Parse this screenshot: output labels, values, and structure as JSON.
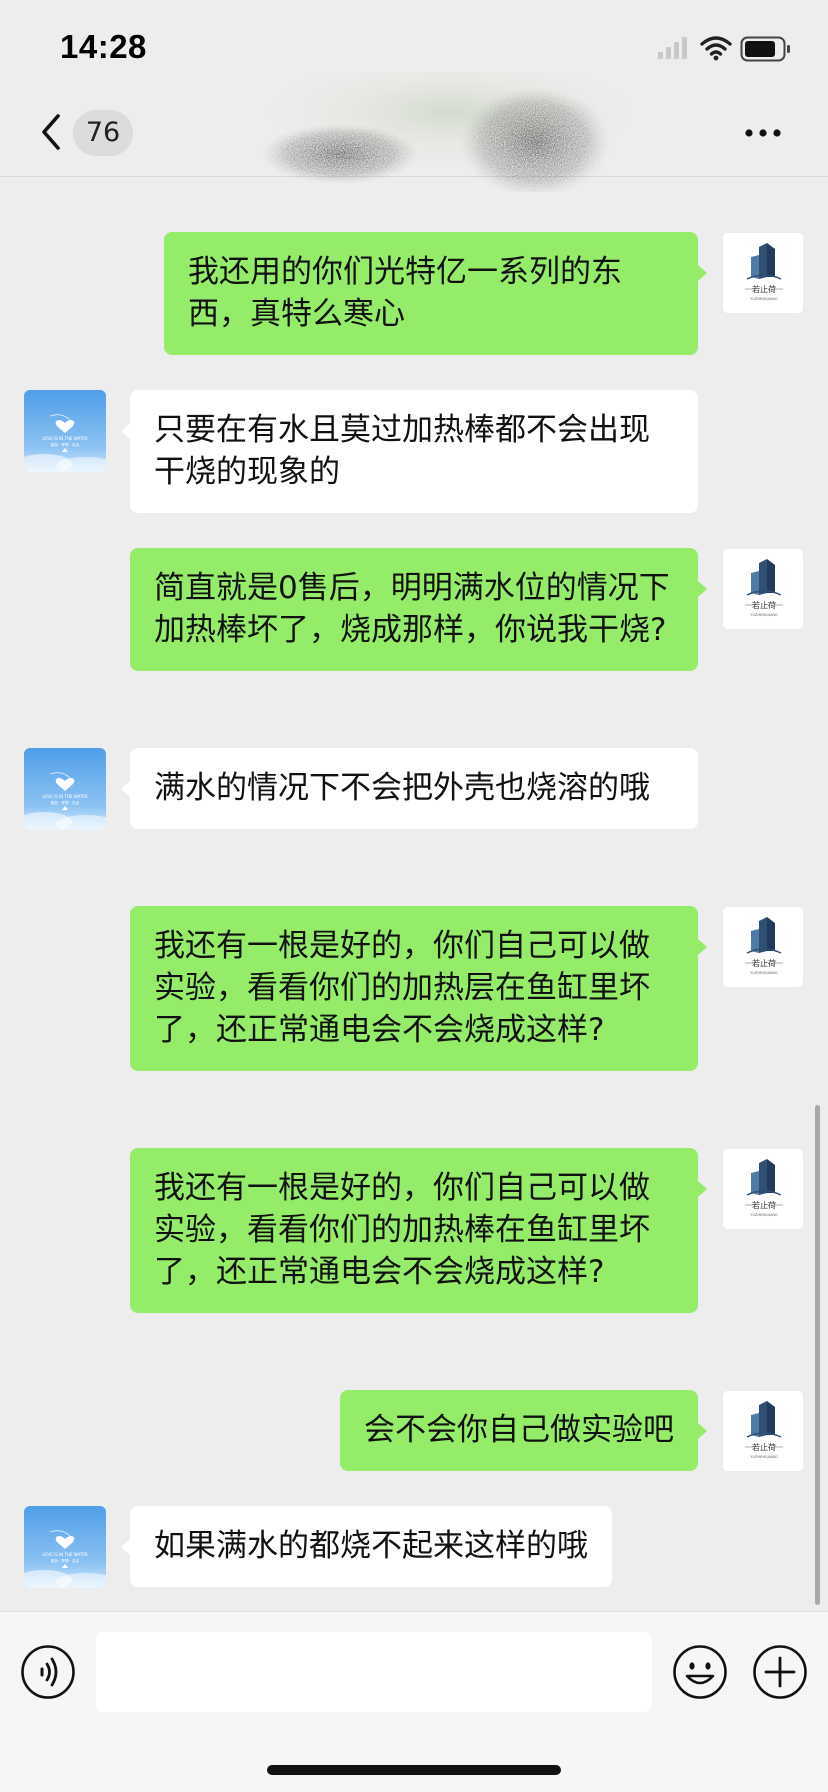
{
  "status_bar": {
    "time": "14:28"
  },
  "header": {
    "unread_count": "76"
  },
  "messages": [
    {
      "side": "right",
      "text": "我还用的你们光特亿一系列的东西，真特么寒心"
    },
    {
      "side": "left",
      "text": "只要在有水且莫过加热棒都不会出现干烧的现象的"
    },
    {
      "side": "right",
      "text": "简直就是0售后，明明满水位的情况下加热棒坏了，烧成那样，你说我干烧?"
    },
    {
      "side": "left",
      "text": "满水的情况下不会把外壳也烧溶的哦"
    },
    {
      "side": "right",
      "text": "我还有一根是好的，你们自己可以做实验，看看你们的加热层在鱼缸里坏了，还正常通电会不会烧成这样?"
    },
    {
      "side": "right",
      "text": "我还有一根是好的，你们自己可以做实验，看看你们的加热棒在鱼缸里坏了，还正常通电会不会烧成这样?"
    },
    {
      "side": "right",
      "text": "会不会你自己做实验吧"
    },
    {
      "side": "left",
      "text": "如果满水的都烧不起来这样的哦"
    }
  ],
  "contact_avatar": {
    "lines": [
      "LOVE IS IN THE WATER",
      "蓝色 · 梦想 · 自由"
    ]
  },
  "my_avatar": {
    "brand_text": "若止荷",
    "brand_sub": "YUZHENGJIANG"
  },
  "input": {
    "value": ""
  },
  "colors": {
    "my_bubble": "#95ec69",
    "their_bubble": "#ffffff",
    "background": "#ededed"
  }
}
